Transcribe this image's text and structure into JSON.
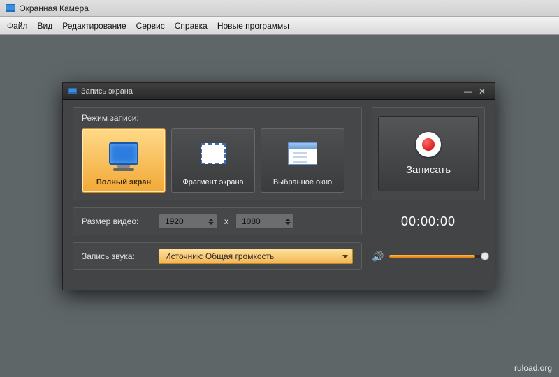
{
  "app": {
    "title": "Экранная Камера"
  },
  "menu": {
    "file": "Файл",
    "view": "Вид",
    "edit": "Редактирование",
    "service": "Сервис",
    "help": "Справка",
    "new_programs": "Новые программы"
  },
  "dialog": {
    "title": "Запись экрана",
    "mode_label": "Режим записи:",
    "modes": {
      "full": "Полный экран",
      "region": "Фрагмент экрана",
      "window": "Выбранное окно"
    },
    "record_label": "Записать",
    "size_label": "Размер видео:",
    "width": "1920",
    "height": "1080",
    "x_sep": "x",
    "timer": "00:00:00",
    "audio_label": "Запись звука:",
    "audio_source": "Источник: Общая громкость"
  },
  "watermark": "ruload.org"
}
